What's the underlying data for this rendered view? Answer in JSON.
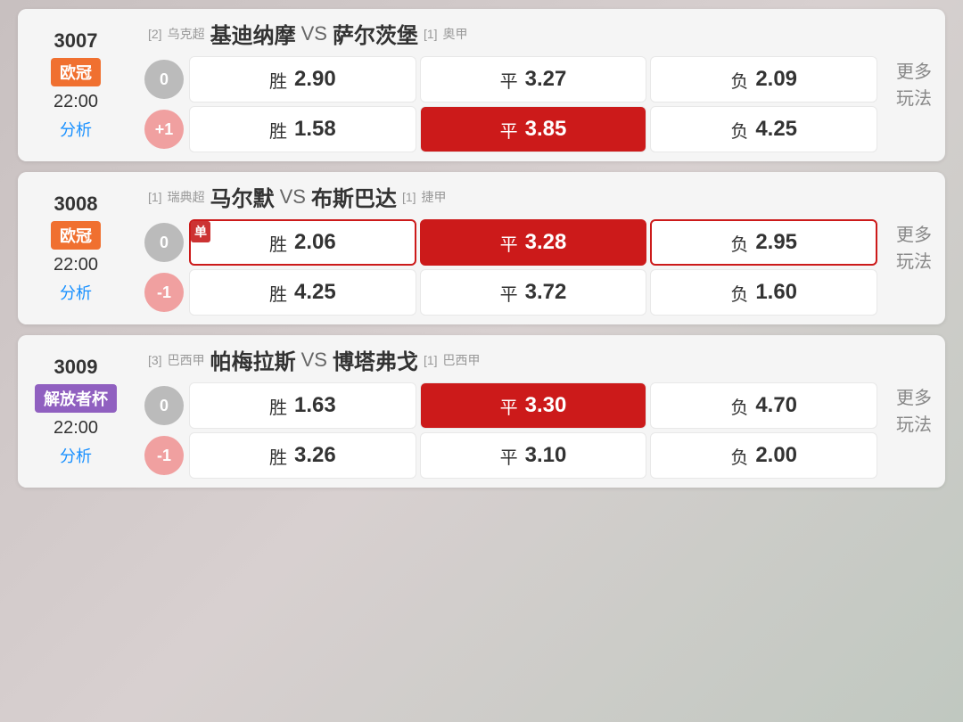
{
  "matches": [
    {
      "id": "3007",
      "league": "欧冠",
      "leagueColor": "orange",
      "time": "22:00",
      "analyze": "分析",
      "leftLeague1": "[2]",
      "leftLeagueLabel1": "乌克超",
      "team1": "基迪纳摩",
      "vs": "VS",
      "rightLeague1": "[1]",
      "rightLeagueLabel1": "奥甲",
      "team2": "萨尔茨堡",
      "rows": [
        {
          "handicap": "0",
          "handicapColor": "gray",
          "cells": [
            {
              "label": "胜",
              "value": "2.90",
              "style": "normal"
            },
            {
              "label": "平",
              "value": "3.27",
              "style": "normal"
            },
            {
              "label": "负",
              "value": "2.09",
              "style": "normal"
            }
          ]
        },
        {
          "handicap": "+1",
          "handicapColor": "pink",
          "cells": [
            {
              "label": "胜",
              "value": "1.58",
              "style": "normal"
            },
            {
              "label": "平",
              "value": "3.85",
              "style": "highlighted"
            },
            {
              "label": "负",
              "value": "4.25",
              "style": "normal"
            }
          ]
        }
      ],
      "more": "更多\n玩法"
    },
    {
      "id": "3008",
      "league": "欧冠",
      "leagueColor": "orange",
      "time": "22:00",
      "analyze": "分析",
      "leftLeague1": "[1]",
      "leftLeagueLabel1": "瑞典超",
      "team1": "马尔默",
      "vs": "VS",
      "rightLeague1": "[1]",
      "rightLeagueLabel1": "捷甲",
      "team2": "布斯巴达",
      "rows": [
        {
          "handicap": "0",
          "handicapColor": "gray",
          "cells": [
            {
              "label": "胜",
              "value": "2.06",
              "style": "outlined",
              "single": true
            },
            {
              "label": "平",
              "value": "3.28",
              "style": "highlighted-outlined"
            },
            {
              "label": "负",
              "value": "2.95",
              "style": "outlined"
            }
          ]
        },
        {
          "handicap": "-1",
          "handicapColor": "pink",
          "cells": [
            {
              "label": "胜",
              "value": "4.25",
              "style": "normal"
            },
            {
              "label": "平",
              "value": "3.72",
              "style": "normal"
            },
            {
              "label": "负",
              "value": "1.60",
              "style": "normal"
            }
          ]
        }
      ],
      "more": "更多\n玩法"
    },
    {
      "id": "3009",
      "league": "解放者杯",
      "leagueColor": "purple",
      "time": "22:00",
      "analyze": "分析",
      "leftLeague1": "[3]",
      "leftLeagueLabel1": "巴西甲",
      "team1": "帕梅拉斯",
      "vs": "VS",
      "rightLeague1": "[1]",
      "rightLeagueLabel1": "巴西甲",
      "team2": "博塔弗戈",
      "rows": [
        {
          "handicap": "0",
          "handicapColor": "gray",
          "cells": [
            {
              "label": "胜",
              "value": "1.63",
              "style": "normal"
            },
            {
              "label": "平",
              "value": "3.30",
              "style": "highlighted"
            },
            {
              "label": "负",
              "value": "4.70",
              "style": "normal"
            }
          ]
        },
        {
          "handicap": "-1",
          "handicapColor": "pink",
          "cells": [
            {
              "label": "胜",
              "value": "3.26",
              "style": "normal"
            },
            {
              "label": "平",
              "value": "3.10",
              "style": "normal"
            },
            {
              "label": "负",
              "value": "2.00",
              "style": "normal"
            }
          ]
        }
      ],
      "more": "更多\n玩法"
    }
  ]
}
